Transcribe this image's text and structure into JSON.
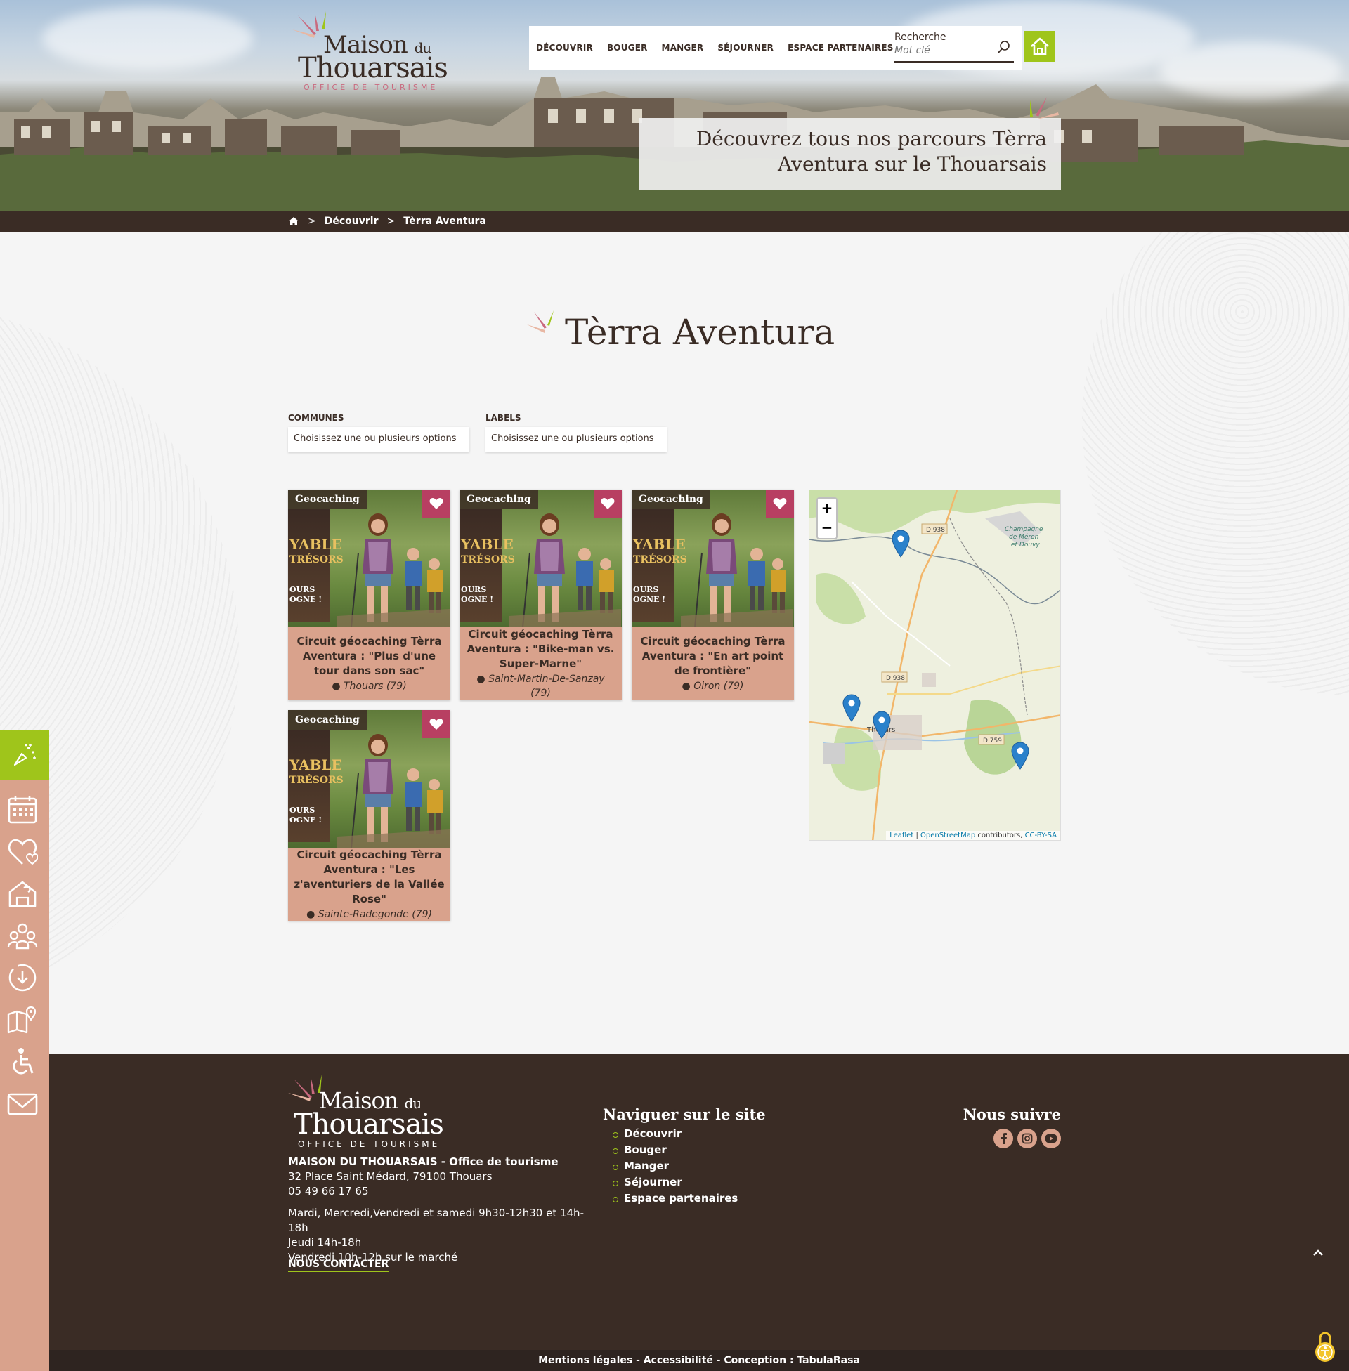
{
  "site": {
    "logo_line1": "Maison",
    "logo_line1_small": "du",
    "logo_line2": "Thouarsais",
    "logo_line3": "OFFICE DE TOURISME"
  },
  "nav": {
    "items": [
      "DÉCOUVRIR",
      "BOUGER",
      "MANGER",
      "SÉJOURNER",
      "ESPACE PARTENAIRES"
    ],
    "search_label": "Recherche",
    "search_placeholder": "Mot clé"
  },
  "hero": {
    "banner_line1": "Découvrez tous nos parcours Tèrra",
    "banner_line2": "Aventura sur le Thouarsais"
  },
  "breadcrumb": {
    "items": [
      "Découvrir",
      "Tèrra Aventura"
    ]
  },
  "page": {
    "title": "Tèrra Aventura"
  },
  "filters": [
    {
      "label": "COMMUNES",
      "placeholder": "Choisissez une ou plusieurs options"
    },
    {
      "label": "LABELS",
      "placeholder": "Choisissez une ou plusieurs options"
    }
  ],
  "cards": [
    {
      "tag": "Geocaching",
      "title": "Circuit géocaching Tèrra Aventura : \"Plus d'une tour dans son sac\"",
      "location": "Thouars (79)"
    },
    {
      "tag": "Geocaching",
      "title": "Circuit géocaching Tèrra Aventura : \"Bike-man vs. Super-Marne\"",
      "location": "Saint-Martin-De-Sanzay (79)"
    },
    {
      "tag": "Geocaching",
      "title": "Circuit géocaching Tèrra Aventura : \"En art point de frontière\"",
      "location": "Oiron (79)"
    },
    {
      "tag": "Geocaching",
      "title": "Circuit géocaching Tèrra Aventura : \"Les z'aventuriers de la Vallée Rose\"",
      "location": "Sainte-Radegonde (79)"
    }
  ],
  "poster": {
    "line1": "YABLE",
    "line2": "TRÉSORS",
    "line3": "OURS",
    "line4": "OGNE !"
  },
  "map": {
    "zoom_in": "+",
    "zoom_out": "−",
    "labels": {
      "road1": "D 938",
      "road2": "D 938",
      "road3": "D 759",
      "town": "Thouars",
      "place1": "Champagne",
      "place2": "de Méron",
      "place3": "et Douvy"
    },
    "attribution_leaflet": "Leaflet",
    "attribution_sep": " | ",
    "attribution_osm": "OpenStreetMap",
    "attribution_contrib": " contributors, ",
    "attribution_license": "CC-BY-SA"
  },
  "footer": {
    "org_name": "MAISON DU THOUARSAIS - Office de tourisme",
    "address": "32 Place Saint Médard, 79100 Thouars",
    "phone": "05 49 66 17 65",
    "hours_1": "Mardi, Mercredi,Vendredi et samedi 9h30-12h30 et 14h-",
    "hours_1b": "18h",
    "hours_2": "Jeudi 14h-18h",
    "hours_3": "Vendredi 10h-12h sur le marché",
    "contact": "NOUS CONTACTER",
    "nav_title": "Naviguer sur le site",
    "nav_items": [
      "Découvrir",
      "Bouger",
      "Manger",
      "Séjourner",
      "Espace partenaires"
    ],
    "follow_title": "Nous suivre",
    "bottom_1": "Mentions légales",
    "bottom_2": "Accessibilité",
    "bottom_3": "Conception : TabulaRasa",
    "bottom_sep": " - "
  },
  "colors": {
    "brand_dark": "#3a2c25",
    "accent_green": "#9fc51b",
    "card_rose": "#d9a28c",
    "fav_pink": "#b83f62",
    "marker_blue": "#2a81cb"
  }
}
